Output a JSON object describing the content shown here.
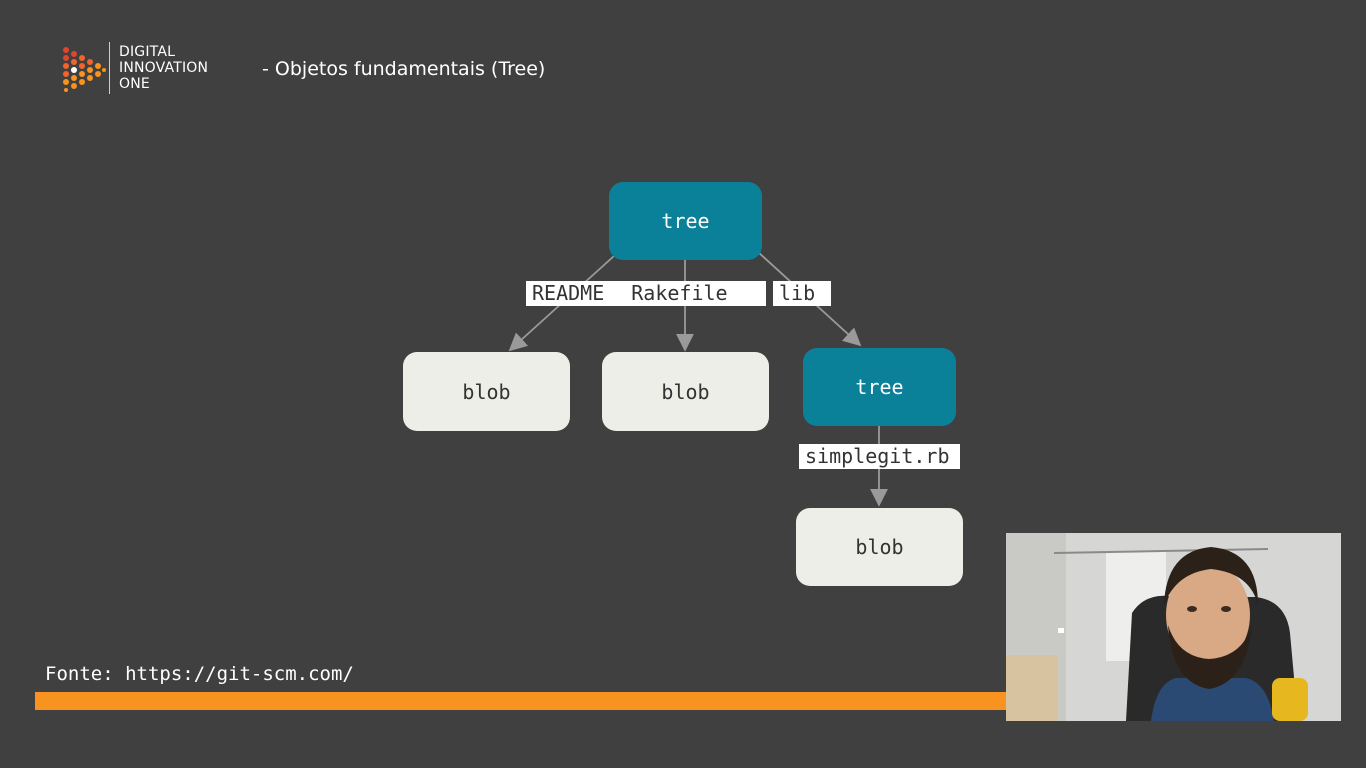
{
  "header": {
    "logo": {
      "lines": [
        "DIGITAL",
        "INNOVATION",
        "ONE"
      ]
    },
    "title": "- Objetos fundamentais (Tree)"
  },
  "diagram": {
    "nodes": {
      "root_tree": "tree",
      "blob_readme": "blob",
      "blob_rakefile": "blob",
      "lib_tree": "tree",
      "blob_simplegit": "blob"
    },
    "edge_labels": {
      "readme": "README",
      "rakefile": "Rakefile",
      "lib": "lib",
      "simplegit": "simplegit.rb"
    }
  },
  "footer": {
    "source": "Fonte: https://git-scm.com/"
  },
  "colors": {
    "background": "#404040",
    "tree_node": "#0b8099",
    "blob_node": "#eeeee8",
    "accent_bar": "#f7931e",
    "logo_orange": "#f7931e",
    "logo_red": "#e0452e"
  },
  "icons": {
    "logo": "dio-play-dots-icon",
    "arrow": "arrowhead-icon"
  }
}
